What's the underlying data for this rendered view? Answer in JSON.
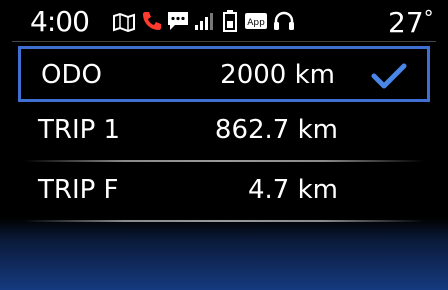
{
  "status_bar": {
    "time": "4:00",
    "temperature": "27",
    "temperature_unit": "°",
    "icons": [
      "map-icon",
      "phone-icon",
      "message-icon",
      "signal-icon",
      "battery-icon",
      "app-icon",
      "headset-icon"
    ]
  },
  "odometer": {
    "items": [
      {
        "label": "ODO",
        "value": "2000 km",
        "selected": true
      },
      {
        "label": "TRIP 1",
        "value": "862.7 km",
        "selected": false
      },
      {
        "label": "TRIP F",
        "value": "4.7 km",
        "selected": false
      }
    ]
  },
  "colors": {
    "selection_border": "#3f6fd0",
    "check": "#4a86e8",
    "phone_icon": "#ff3b30"
  }
}
